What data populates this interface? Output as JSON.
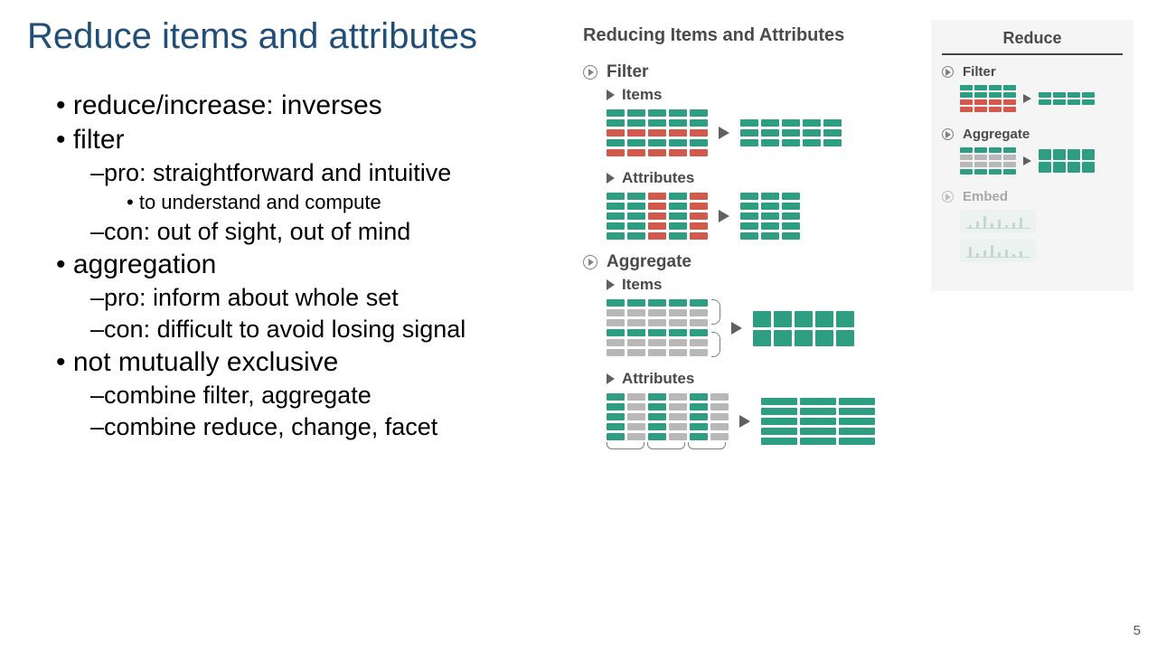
{
  "title": "Reduce items and attributes",
  "page_number": "5",
  "bullets": {
    "b1": "reduce/increase: inverses",
    "b2": "filter",
    "b2a": "pro: straightforward and intuitive",
    "b2a1": "to understand and compute",
    "b2b": "con: out of sight, out of mind",
    "b3": "aggregation",
    "b3a": "pro: inform about whole set",
    "b3b": "con: difficult to avoid losing signal",
    "b4": "not mutually exclusive",
    "b4a": "combine filter, aggregate",
    "b4b": "combine reduce, change, facet"
  },
  "mid": {
    "title": "Reducing Items and Attributes",
    "filter": "Filter",
    "items": "Items",
    "attributes": "Attributes",
    "aggregate": "Aggregate"
  },
  "sidebar": {
    "title": "Reduce",
    "filter": "Filter",
    "aggregate": "Aggregate",
    "embed": "Embed"
  }
}
